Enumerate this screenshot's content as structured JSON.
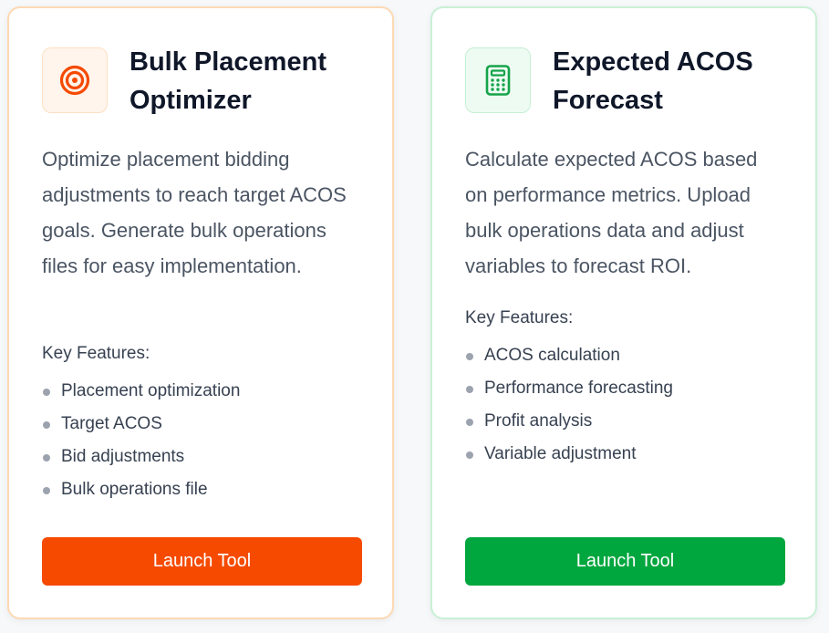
{
  "cards": [
    {
      "title": "Bulk Placement Optimizer",
      "icon": "target-icon",
      "description": "Optimize placement bidding adjustments to reach target ACOS goals. Generate bulk operations files for easy implementation.",
      "features_label": "Key Features:",
      "features": [
        "Placement optimization",
        "Target ACOS",
        "Bid adjustments",
        "Bulk operations file"
      ],
      "button_label": "Launch Tool",
      "accent_color": "#f54a00"
    },
    {
      "title": "Expected ACOS Forecast",
      "icon": "calculator-icon",
      "description": "Calculate expected ACOS based on performance metrics. Upload bulk operations data and adjust variables to forecast ROI.",
      "features_label": "Key Features:",
      "features": [
        "ACOS calculation",
        "Performance forecasting",
        "Profit analysis",
        "Variable adjustment"
      ],
      "button_label": "Launch Tool",
      "accent_color": "#00a63e"
    }
  ]
}
